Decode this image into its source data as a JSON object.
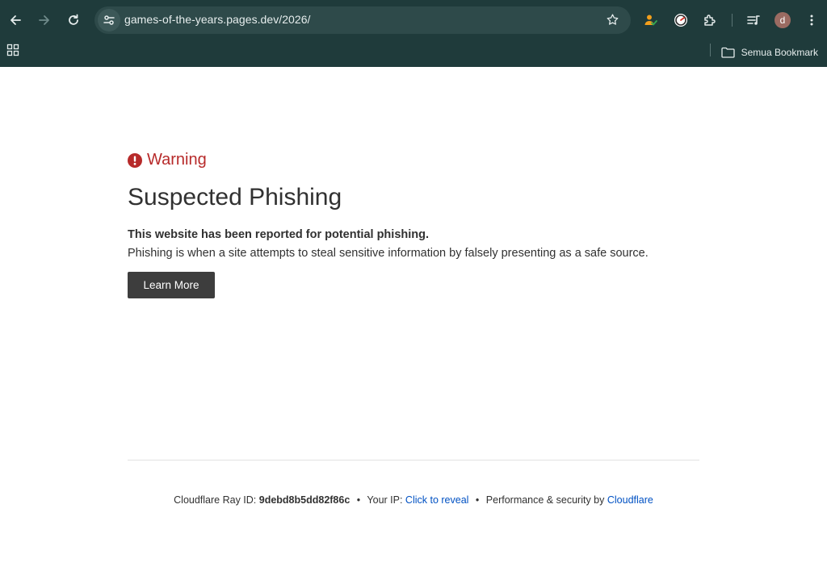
{
  "browser": {
    "url": "games-of-the-years.pages.dev/2026/",
    "avatar_letter": "d",
    "bookmarks_label": "Semua Bookmark"
  },
  "warning": {
    "label": "Warning",
    "title": "Suspected Phishing",
    "bold_text": "This website has been reported for potential phishing.",
    "description": "Phishing is when a site attempts to steal sensitive information by falsely presenting as a safe source.",
    "button_label": "Learn More"
  },
  "footer": {
    "ray_label": "Cloudflare Ray ID:",
    "ray_id": "9debd8b5dd82f86c",
    "ip_label": "Your IP:",
    "ip_link": "Click to reveal",
    "perf_label": "Performance & security by",
    "perf_link": "Cloudflare",
    "separator": "•"
  },
  "colors": {
    "chrome_bg": "#1f3b3b",
    "warning_red": "#b72a2a",
    "link_blue": "#0051c3",
    "button_bg": "#3d3d3d"
  },
  "icons": [
    "back-icon",
    "forward-icon",
    "reload-icon",
    "site-settings-icon",
    "star-icon",
    "extension-person-icon",
    "extension-speed-icon",
    "puzzle-extensions-icon",
    "media-queue-icon",
    "kebab-menu-icon",
    "apps-grid-icon",
    "folder-icon",
    "warning-exclamation-icon"
  ]
}
